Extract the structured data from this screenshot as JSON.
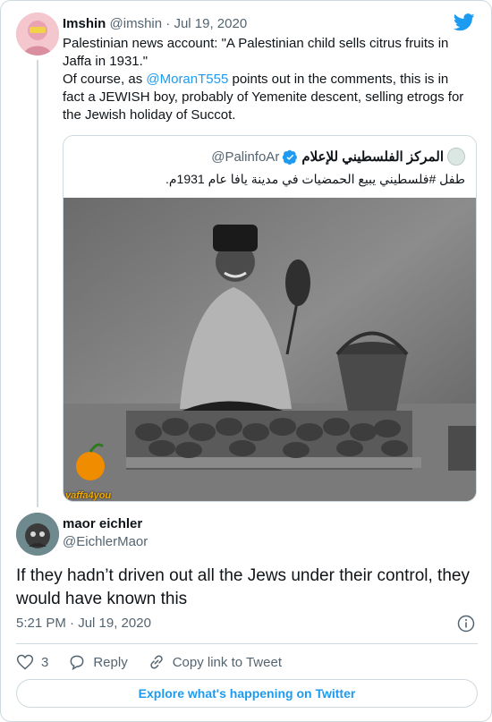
{
  "parent_tweet": {
    "author_name": "Imshin",
    "author_handle": "@imshin",
    "separator": "·",
    "date": "Jul 19, 2020",
    "text_line1": "Palestinian news account: \"A Palestinian child sells citrus fruits in Jaffa in 1931.\"",
    "text_prefix": "Of course, as ",
    "mention": "@MoranT555",
    "text_suffix": " points out in the comments, this is in fact a JEWISH boy, probably of Yemenite descent, selling etrogs for the Jewish holiday of Succot."
  },
  "quoted_tweet": {
    "author_name": "المركز الفلسطيني للإعلام",
    "author_handle": "@PalinfoAr",
    "text": "طفل #فلسطيني يبيع الحمضيات في مدينة يافا عام 1931م.",
    "photo_watermark": "yaffa4you",
    "photo_logo_text": "يافا"
  },
  "reply_tweet": {
    "author_name": "maor eichler",
    "author_handle": "@EichlerMaor",
    "text": "If they hadn’t driven out all the Jews under their control, they would have known this",
    "timestamp": "5:21 PM · Jul 19, 2020"
  },
  "actions": {
    "like_count": "3",
    "reply_label": "Reply",
    "copy_link_label": "Copy link to Tweet"
  },
  "explore_button_label": "Explore what's happening on Twitter",
  "colors": {
    "accent": "#1d9bf0",
    "text": "#0f1419",
    "secondary_text": "#536471",
    "border": "#cfd9de"
  }
}
